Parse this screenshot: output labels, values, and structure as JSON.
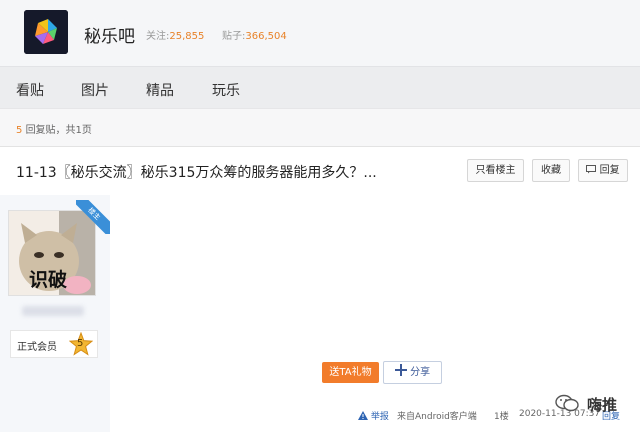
{
  "forum": {
    "name": "秘乐吧",
    "follow_label": "关注:",
    "follow_count": "25,855",
    "post_label": "贴子:",
    "post_count": "366,504"
  },
  "nav": {
    "tabs": [
      {
        "label": "看贴"
      },
      {
        "label": "图片"
      },
      {
        "label": "精品"
      },
      {
        "label": "玩乐"
      }
    ]
  },
  "pagination": {
    "count": "5",
    "text": "回复贴，共1页"
  },
  "thread": {
    "title": "11-13〖秘乐交流〗秘乐315万众筹的服务器能用多久？...",
    "only_op_label": "只看楼主",
    "favorite_label": "收藏",
    "reply_label": "回复"
  },
  "author": {
    "badge_label": "楼主",
    "avatar_text": "识破",
    "member_label": "正式会员",
    "level": "5"
  },
  "post": {
    "gift_button_label": "送TA礼物",
    "share_button_label": "分享",
    "report_label": "举报",
    "client_text": "来自Android客户端",
    "floor": "1楼",
    "timestamp": "2020-11-13 07:37",
    "reply_link": "回复"
  },
  "watermark": {
    "text": "嗨推"
  },
  "colors": {
    "accent_orange": "#f27c2b",
    "stat_orange": "#e8832a",
    "link_blue": "#2d64b3",
    "badge_blue": "#3a8fd8"
  }
}
